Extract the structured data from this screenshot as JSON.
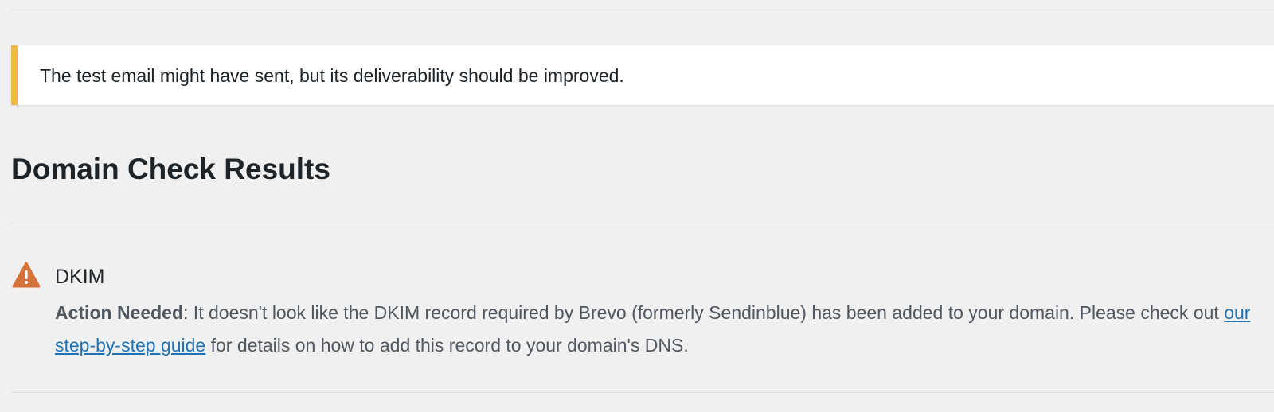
{
  "notice": {
    "message": "The test email might have sent, but its deliverability should be improved.",
    "accent_color": "#f0b849"
  },
  "section": {
    "title": "Domain Check Results"
  },
  "check": {
    "icon": "warning-icon",
    "icon_color": "#d6733a",
    "name": "DKIM",
    "status_label": "Action Needed",
    "status_separator": ":",
    "text_before_link": " It doesn't look like the DKIM record required by Brevo (formerly Sendinblue) has been added to your domain. Please check out ",
    "link_text": "our step-by-step guide",
    "text_after_link": " for details on how to add this record to your domain's DNS."
  },
  "colors": {
    "background": "#f0f0f1",
    "link": "#2271b1"
  }
}
